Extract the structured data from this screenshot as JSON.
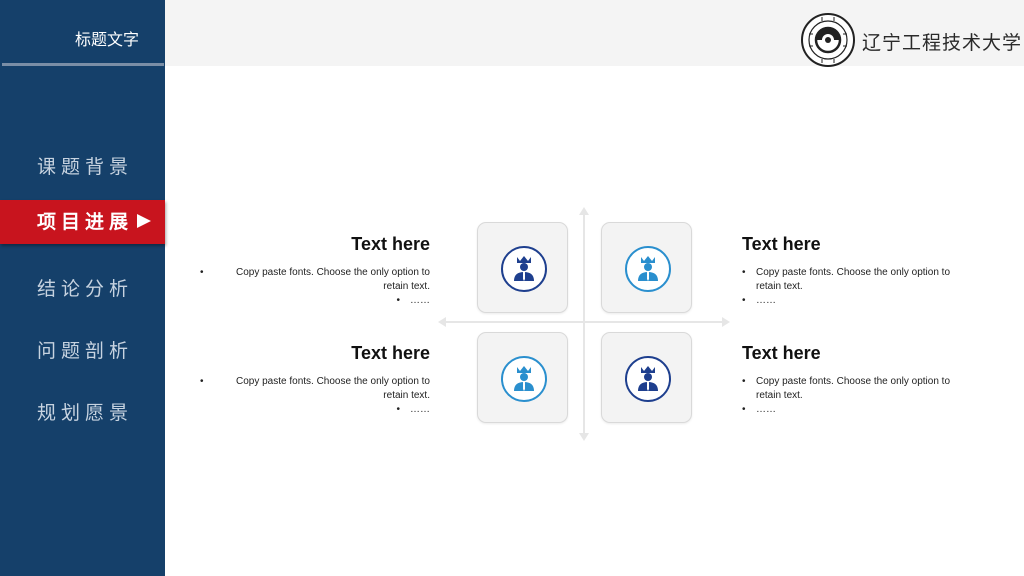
{
  "sidebar": {
    "title": "标题文字",
    "items": [
      {
        "label": "课题背景",
        "active": false
      },
      {
        "label": "项目进展",
        "active": true
      },
      {
        "label": "结论分析",
        "active": false
      },
      {
        "label": "问题剖析",
        "active": false
      },
      {
        "label": "规划愿景",
        "active": false
      }
    ]
  },
  "header": {
    "university_name": "辽宁工程技术大学"
  },
  "colors": {
    "sidebar_bg": "#15406a",
    "active_red": "#c8141e",
    "icon_dark_blue": "#1e3f8e",
    "icon_light_blue": "#2a8fce"
  },
  "blocks": {
    "top_left": {
      "title": "Text here",
      "line1": "Copy paste fonts. Choose the only option to retain text.",
      "line2": "……"
    },
    "top_right": {
      "title": "Text here",
      "line1": "Copy paste fonts. Choose the only option to retain text.",
      "line2": "……"
    },
    "bottom_left": {
      "title": "Text here",
      "line1": "Copy paste fonts. Choose the only option to retain text.",
      "line2": "……"
    },
    "bottom_right": {
      "title": "Text here",
      "line1": "Copy paste fonts. Choose the only option to retain text.",
      "line2": "……"
    }
  },
  "icons": {
    "tile_1": "person-crown-icon",
    "tile_2": "person-crown-icon",
    "tile_3": "person-crown-icon",
    "tile_4": "person-crown-icon"
  }
}
